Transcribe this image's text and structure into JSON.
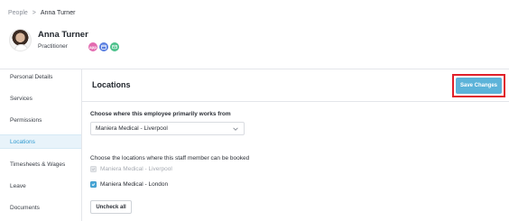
{
  "breadcrumb": {
    "parent": "People",
    "separator": ">",
    "current": "Anna Turner"
  },
  "profile": {
    "name": "Anna Turner",
    "role": "Practitioner",
    "badges": [
      {
        "icon": "app-icon",
        "text": "app",
        "color": "#e36bb0"
      },
      {
        "icon": "calendar-icon",
        "text": "",
        "color": "#5a7fe0"
      },
      {
        "icon": "mail-icon",
        "text": "",
        "color": "#4cc18b"
      }
    ]
  },
  "sidebar": {
    "items": [
      {
        "label": "Personal Details",
        "active": false
      },
      {
        "label": "Services",
        "active": false
      },
      {
        "label": "Permissions",
        "active": false
      },
      {
        "label": "Locations",
        "active": true
      },
      {
        "label": "Timesheets & Wages",
        "active": false
      },
      {
        "label": "Leave",
        "active": false
      },
      {
        "label": "Documents",
        "active": false
      }
    ]
  },
  "content": {
    "title": "Locations",
    "save_label": "Save Changes",
    "primary_label": "Choose where this employee primarily works from",
    "primary_value": "Maniera Medical - Liverpool",
    "bookable_label": "Choose the locations where this staff member can be booked",
    "locations": [
      {
        "label": "Maniera Medical - Liverpool",
        "checked": true,
        "disabled": true
      },
      {
        "label": "Maniera Medical - London",
        "checked": true,
        "disabled": false
      }
    ],
    "uncheck_label": "Uncheck all"
  },
  "colors": {
    "accent": "#5cb3d9",
    "highlight": "#e0202a",
    "active_bg": "#e8f3fa"
  }
}
